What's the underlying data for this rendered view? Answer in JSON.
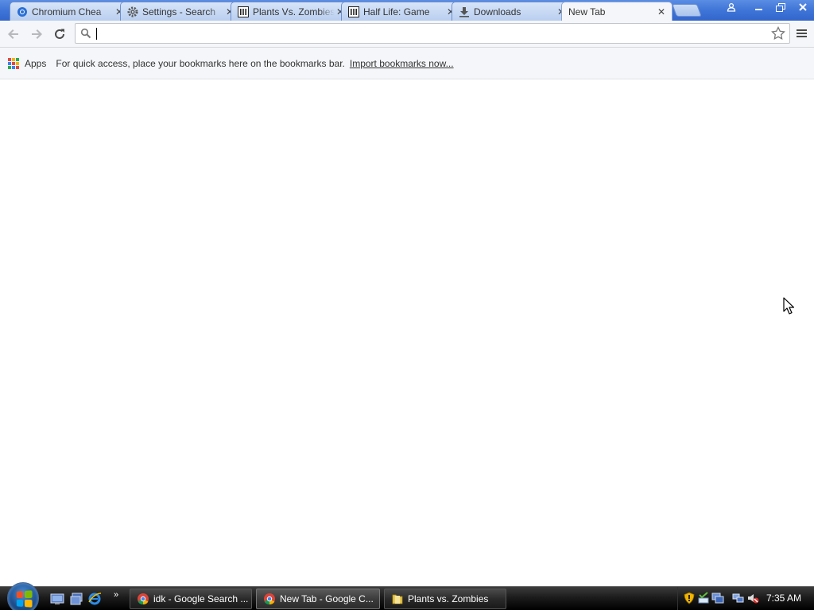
{
  "tabs": [
    {
      "title": "Chromium Chea",
      "icon": "chromium-icon",
      "active": false
    },
    {
      "title": "Settings - Search",
      "icon": "gear-icon",
      "active": false
    },
    {
      "title": "Plants Vs. Zombies",
      "icon": "museum-icon",
      "active": false
    },
    {
      "title": "Half Life: Game",
      "icon": "museum-icon",
      "active": false
    },
    {
      "title": "Downloads",
      "icon": "download-icon",
      "active": false
    },
    {
      "title": "New Tab",
      "icon": "",
      "active": true
    }
  ],
  "omnibox": {
    "value": "",
    "placeholder": ""
  },
  "bookmarks_bar": {
    "apps_label": "Apps",
    "message": "For quick access, place your bookmarks here on the bookmarks bar.",
    "import_link": "Import bookmarks now..."
  },
  "taskbar": {
    "windows": [
      {
        "label": "idk - Google Search ...",
        "icon": "chrome-icon",
        "active": false
      },
      {
        "label": "New Tab - Google C...",
        "icon": "chrome-icon",
        "active": true
      },
      {
        "label": "Plants vs. Zombies",
        "icon": "folder-icon",
        "active": false
      }
    ],
    "quicklaunch_more": "»",
    "clock": "7:35 AM"
  },
  "colors": {
    "titlebar": "#3d72d6",
    "apps_grid": [
      "#e04a3f",
      "#f2b400",
      "#2da94f",
      "#3b82f0",
      "#e04a3f",
      "#f2b400",
      "#2da94f",
      "#3b82f0",
      "#e04a3f"
    ]
  }
}
